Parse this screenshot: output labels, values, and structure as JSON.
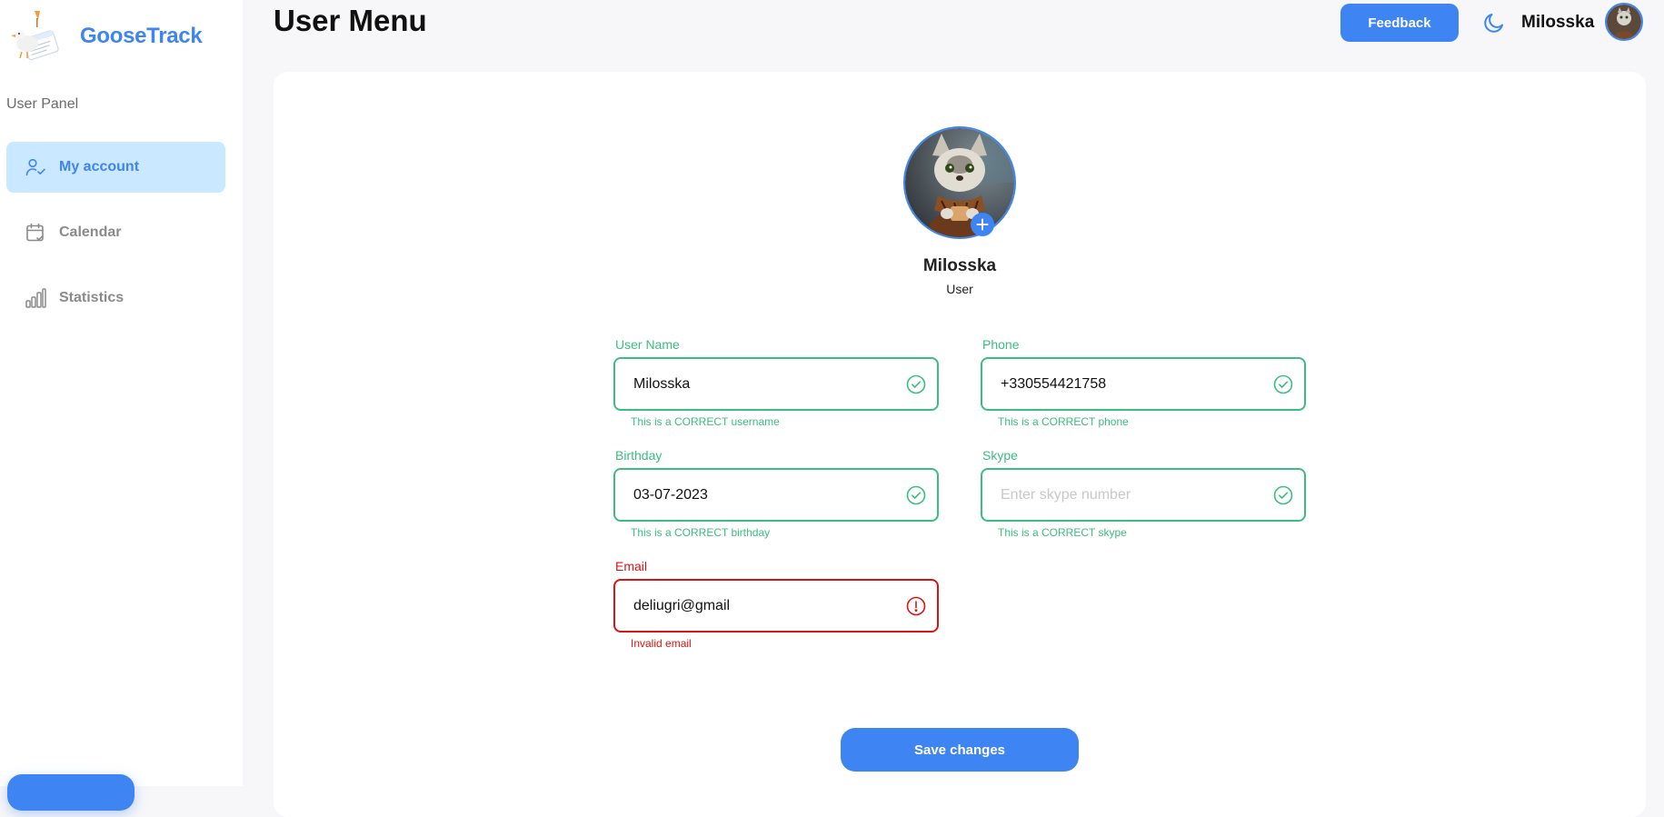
{
  "app": {
    "name": "GooseTrack"
  },
  "sidebar": {
    "panel_title": "User Panel",
    "items": [
      {
        "label": "My account",
        "icon": "user-check-icon",
        "active": true
      },
      {
        "label": "Calendar",
        "icon": "calendar-check-icon",
        "active": false
      },
      {
        "label": "Statistics",
        "icon": "bar-chart-icon",
        "active": false
      }
    ]
  },
  "header": {
    "title": "User Menu",
    "feedback_label": "Feedback",
    "user_name": "Milosska"
  },
  "profile": {
    "name": "Milosska",
    "role": "User"
  },
  "form": {
    "username": {
      "label": "User Name",
      "value": "Milosska",
      "hint": "This is a CORRECT username",
      "status": "valid"
    },
    "phone": {
      "label": "Phone",
      "value": "+330554421758",
      "hint": "This is a CORRECT phone",
      "status": "valid"
    },
    "birthday": {
      "label": "Birthday",
      "value": "03-07-2023",
      "hint": "This is a CORRECT birthday",
      "status": "valid"
    },
    "skype": {
      "label": "Skype",
      "value": "",
      "placeholder": "Enter skype number",
      "hint": "This is a CORRECT skype",
      "status": "valid"
    },
    "email": {
      "label": "Email",
      "value": "deliugri@gmail",
      "hint": "Invalid email",
      "status": "error"
    },
    "save_label": "Save changes"
  },
  "colors": {
    "accent": "#3e85f3",
    "active_nav_bg": "#cae8ff",
    "valid": "#3cbc81",
    "error": "#da1414"
  }
}
